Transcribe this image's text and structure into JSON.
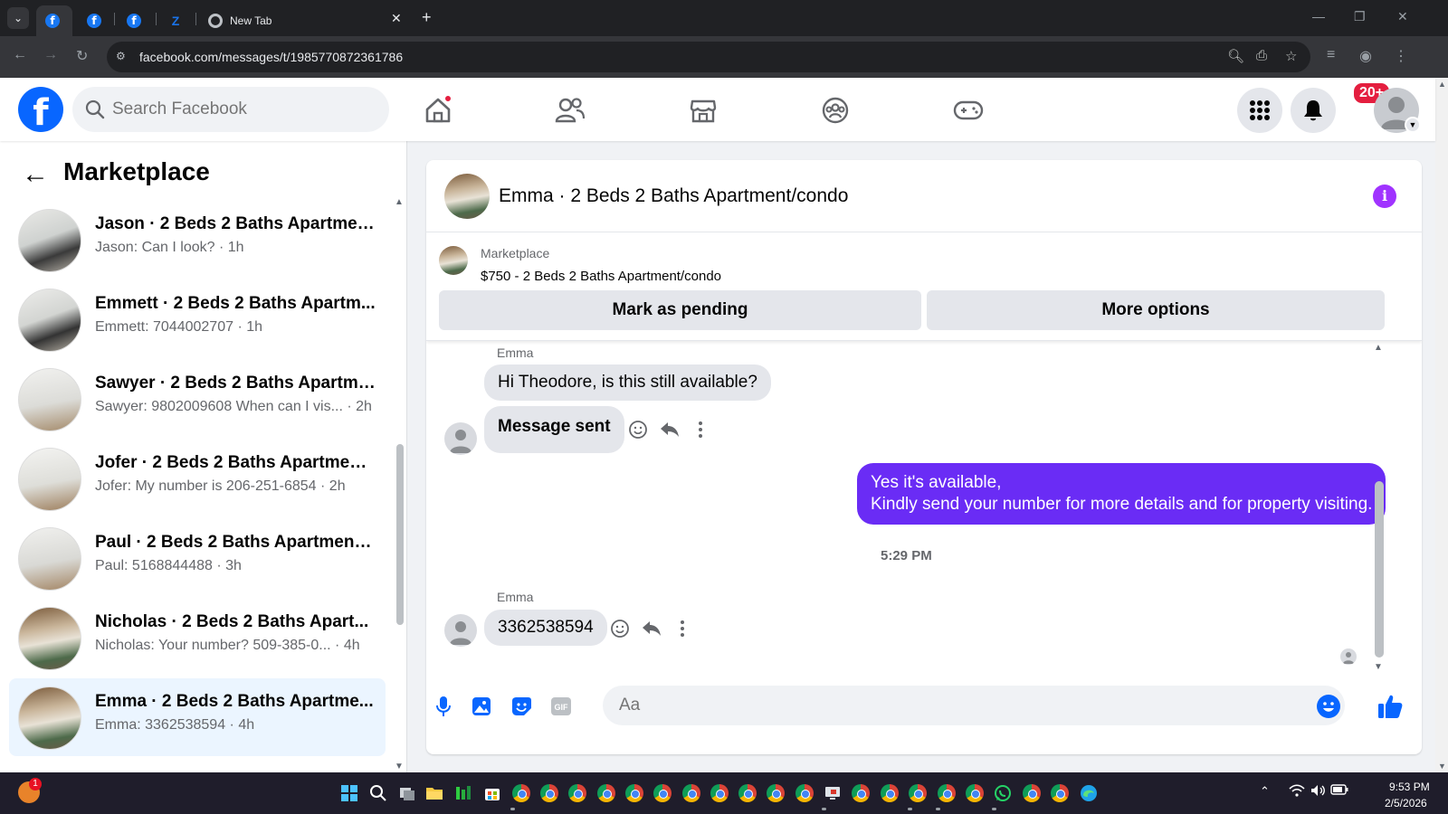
{
  "browser": {
    "tabs": [
      {
        "label": "",
        "icon": "facebook-favicon",
        "active": true
      },
      {
        "label": "",
        "icon": "facebook-favicon",
        "active": false
      },
      {
        "label": "",
        "icon": "facebook-favicon",
        "active": false
      },
      {
        "label": "",
        "icon": "zillow-favicon",
        "active": false
      },
      {
        "label": "New Tab",
        "icon": "chrome-favicon",
        "active": false
      }
    ],
    "url": "facebook.com/messages/t/1985770872361786"
  },
  "header": {
    "search_placeholder": "Search Facebook",
    "notification_count": "20+",
    "nav_icons": [
      "home-icon",
      "friends-icon",
      "marketplace-icon",
      "groups-icon",
      "gaming-icon"
    ]
  },
  "sidebar": {
    "title": "Marketplace",
    "conversations": [
      {
        "name": "Jason · 2 Beds 2 Baths Apartmen...",
        "preview": "Jason: Can I look? · 1h"
      },
      {
        "name": "Emmett · 2 Beds 2 Baths Apartm...",
        "preview": "Emmett: 7044002707 · 1h"
      },
      {
        "name": "Sawyer · 2 Beds 2 Baths Apartme...",
        "preview": "Sawyer: 9802009608 When can I vis... · 2h"
      },
      {
        "name": "Jofer · 2 Beds 2 Baths Apartment...",
        "preview": "Jofer: My number is 206-251-6854 · 2h"
      },
      {
        "name": "Paul · 2 Beds 2 Baths Apartment/...",
        "preview": "Paul: 5168844488 · 3h"
      },
      {
        "name": "Nicholas · 2 Beds 2 Baths Apart...",
        "preview": "Nicholas: Your number? 509-385-0...  · 4h"
      },
      {
        "name": "Emma · 2 Beds 2 Baths Apartme...",
        "preview": "Emma: 3362538594 · 4h"
      }
    ]
  },
  "chat": {
    "title": "Emma · 2 Beds 2 Baths Apartment/condo",
    "listing": {
      "source": "Marketplace",
      "title": "$750 - 2 Beds 2 Baths Apartment/condo",
      "mark_pending": "Mark as pending",
      "more_options": "More options"
    },
    "messages": {
      "sender1": "Emma",
      "msg1": "Hi Theodore, is this still available?",
      "msg2": "Message sent",
      "out_line1": "Yes it's available,",
      "out_line2": "Kindly send your number for more details and for property visiting.",
      "timestamp": "5:29 PM",
      "sender2": "Emma",
      "msg3": "3362538594"
    },
    "composer_placeholder": "Aa"
  },
  "taskbar": {
    "time": "9:53 PM",
    "date": "2/5/2026",
    "widget_badge": "1"
  },
  "colors": {
    "fb_blue": "#0866ff",
    "outgoing_bubble": "#6a2cf5",
    "selected_row": "#ebf5ff",
    "badge_red": "#e41e3f"
  }
}
